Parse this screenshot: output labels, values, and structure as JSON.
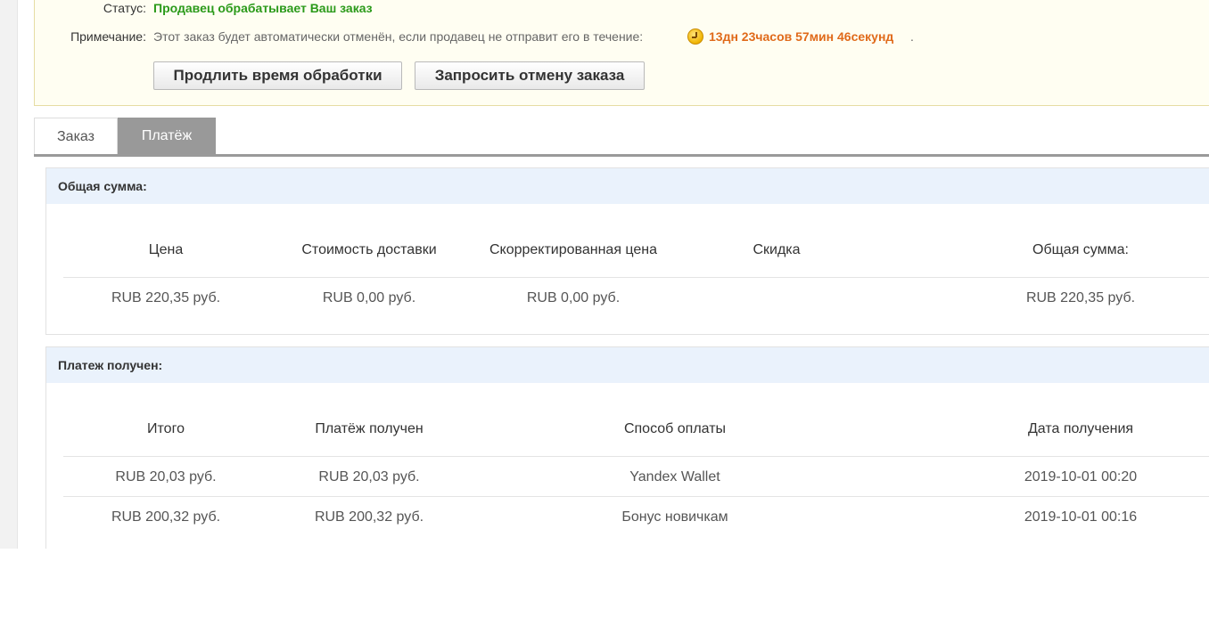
{
  "status_section": {
    "status_label": "Статус:",
    "status_value": "Продавец обрабатывает Ваш заказ",
    "note_label": "Примечание:",
    "note_text": "Этот заказ будет автоматически отменён, если продавец не отправит его в течение:",
    "countdown": "13дн 23часов 57мин 46секунд",
    "countdown_suffix": ".",
    "extend_button": "Продлить время обработки",
    "cancel_button": "Запросить отмену заказа",
    "colors": {
      "status": "#2b9a1a",
      "countdown": "#e06a1a"
    }
  },
  "tabs": [
    {
      "label": "Заказ",
      "active": false
    },
    {
      "label": "Платёж",
      "active": true
    }
  ],
  "total_panel": {
    "title": "Общая сумма:",
    "headers": [
      "Цена",
      "Стоимость доставки",
      "Скорректированная цена",
      "Скидка",
      "Общая сумма:"
    ],
    "row": [
      "RUB 220,35 руб.",
      "RUB 0,00 руб.",
      "RUB 0,00 руб.",
      "",
      "RUB 220,35 руб."
    ]
  },
  "payment_panel": {
    "title": "Платеж получен:",
    "headers": [
      "Итого",
      "Платёж получен",
      "Способ оплаты",
      "Дата получения"
    ],
    "rows": [
      [
        "RUB 20,03 руб.",
        "RUB 20,03 руб.",
        "Yandex Wallet",
        "2019-10-01 00:20"
      ],
      [
        "RUB 200,32 руб.",
        "RUB 200,32 руб.",
        "Бонус новичкам",
        "2019-10-01 00:16"
      ]
    ]
  }
}
